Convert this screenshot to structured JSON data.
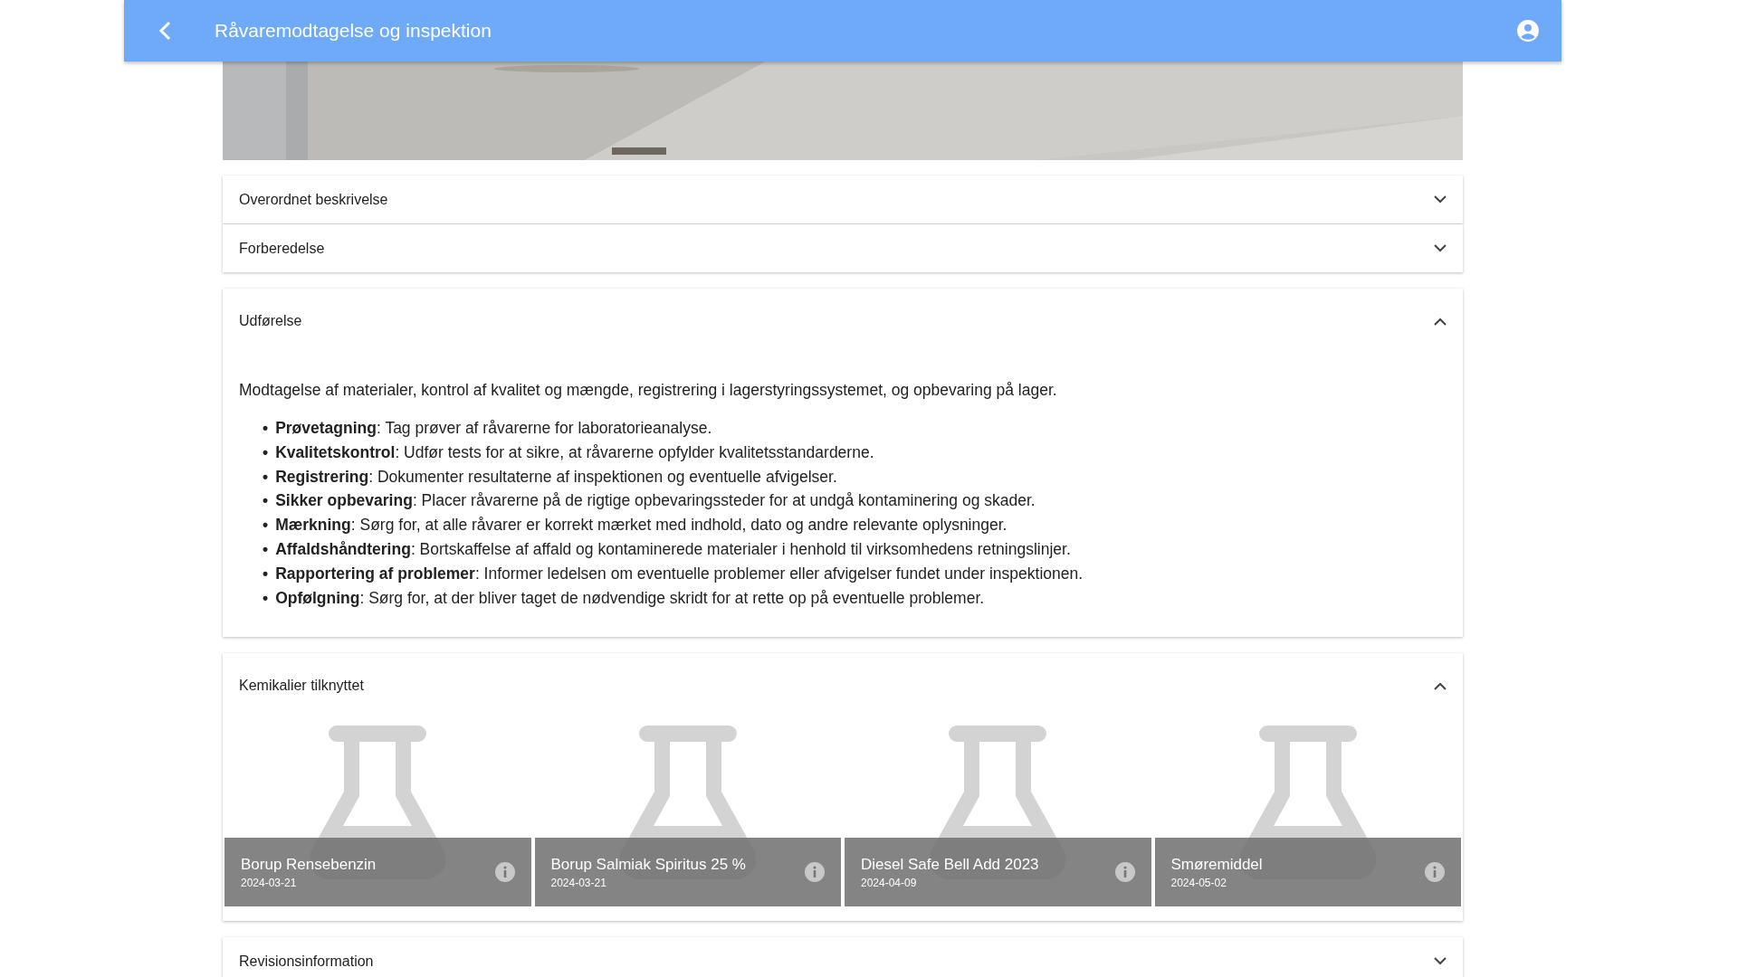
{
  "app_bar": {
    "title": "Råvaremodtagelse og inspektion"
  },
  "sections": [
    {
      "title": "Overordnet beskrivelse",
      "expanded": false
    },
    {
      "title": "Forberedelse",
      "expanded": false
    },
    {
      "title": "Udførelse",
      "expanded": true,
      "description": "Modtagelse af materialer, kontrol af kvalitet og mængde, registrering i lagerstyringssystemet, og opbevaring på lager.",
      "bullet_marker": "•",
      "bullets": [
        "**Prøvetagning**: Tag prøver af råvarerne for laboratorieanalyse.",
        "**Kvalitetskontrol**: Udfør tests for at sikre, at råvarerne opfylder kvalitetsstandarderne.",
        "**Registrering**: Dokumenter resultaterne af inspektionen og eventuelle afvigelser.",
        "**Sikker opbevaring**: Placer råvarerne på de rigtige opbevaringssteder for at undgå kontaminering og skader.",
        "**Mærkning**: Sørg for, at alle råvarer er korrekt mærket med indhold, dato og andre relevante oplysninger.",
        "**Affaldshåndtering**: Bortskaffelse af affald og kontaminerede materialer i henhold til virksomhedens retningslinjer.",
        "**Rapportering af problemer**: Informer ledelsen om eventuelle problemer eller afvigelser fundet under inspektionen.",
        "**Opfølgning**: Sørg for, at der bliver taget de nødvendige skridt for at rette op på eventuelle problemer."
      ]
    },
    {
      "title": "Kemikalier tilknyttet",
      "expanded": true,
      "chemicals": [
        {
          "name": "Borup Rensebenzin",
          "date": "2024-03-21"
        },
        {
          "name": "Borup Salmiak Spiritus 25 %",
          "date": "2024-03-21"
        },
        {
          "name": "Diesel Safe Bell Add 2023",
          "date": "2024-04-09"
        },
        {
          "name": "Smøremiddel",
          "date": "2024-05-02"
        }
      ]
    },
    {
      "title": "Revisionsinformation",
      "expanded": false
    }
  ]
}
